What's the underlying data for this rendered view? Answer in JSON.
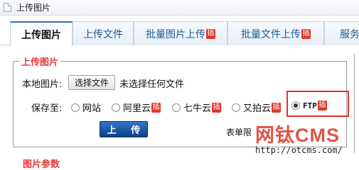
{
  "window": {
    "title": "上传图片",
    "icon": "document-icon"
  },
  "tabs": [
    {
      "label": "上传图片",
      "badge": "",
      "active": true
    },
    {
      "label": "上传文件",
      "badge": ""
    },
    {
      "label": "批量图片上传",
      "badge": "插"
    },
    {
      "label": "批量文件上传",
      "badge": "插"
    },
    {
      "label": "服务",
      "badge": ""
    }
  ],
  "form": {
    "legend": "上传图片",
    "local_label": "本地图片:",
    "file_button": "选择文件",
    "file_status": "未选择任何文件",
    "save_label": "保存至:",
    "save_options": [
      {
        "label": "网站",
        "badge": "",
        "selected": false
      },
      {
        "label": "阿里云",
        "badge": "插",
        "selected": false
      },
      {
        "label": "七牛云",
        "badge": "插",
        "selected": false
      },
      {
        "label": "又拍云",
        "badge": "插",
        "selected": false
      },
      {
        "label": "FTP",
        "badge": "插",
        "selected": true
      }
    ],
    "upload_button": "上 传",
    "limit_text": "表单限"
  },
  "watermark": {
    "logo": "网钛CMS",
    "url": "http://otcms.com/"
  },
  "next_section": "图片参数",
  "colors": {
    "accent": "#2f6fb3",
    "legend": "#e23a3a",
    "badge": "#e2342b",
    "highlight": "#e33030"
  }
}
